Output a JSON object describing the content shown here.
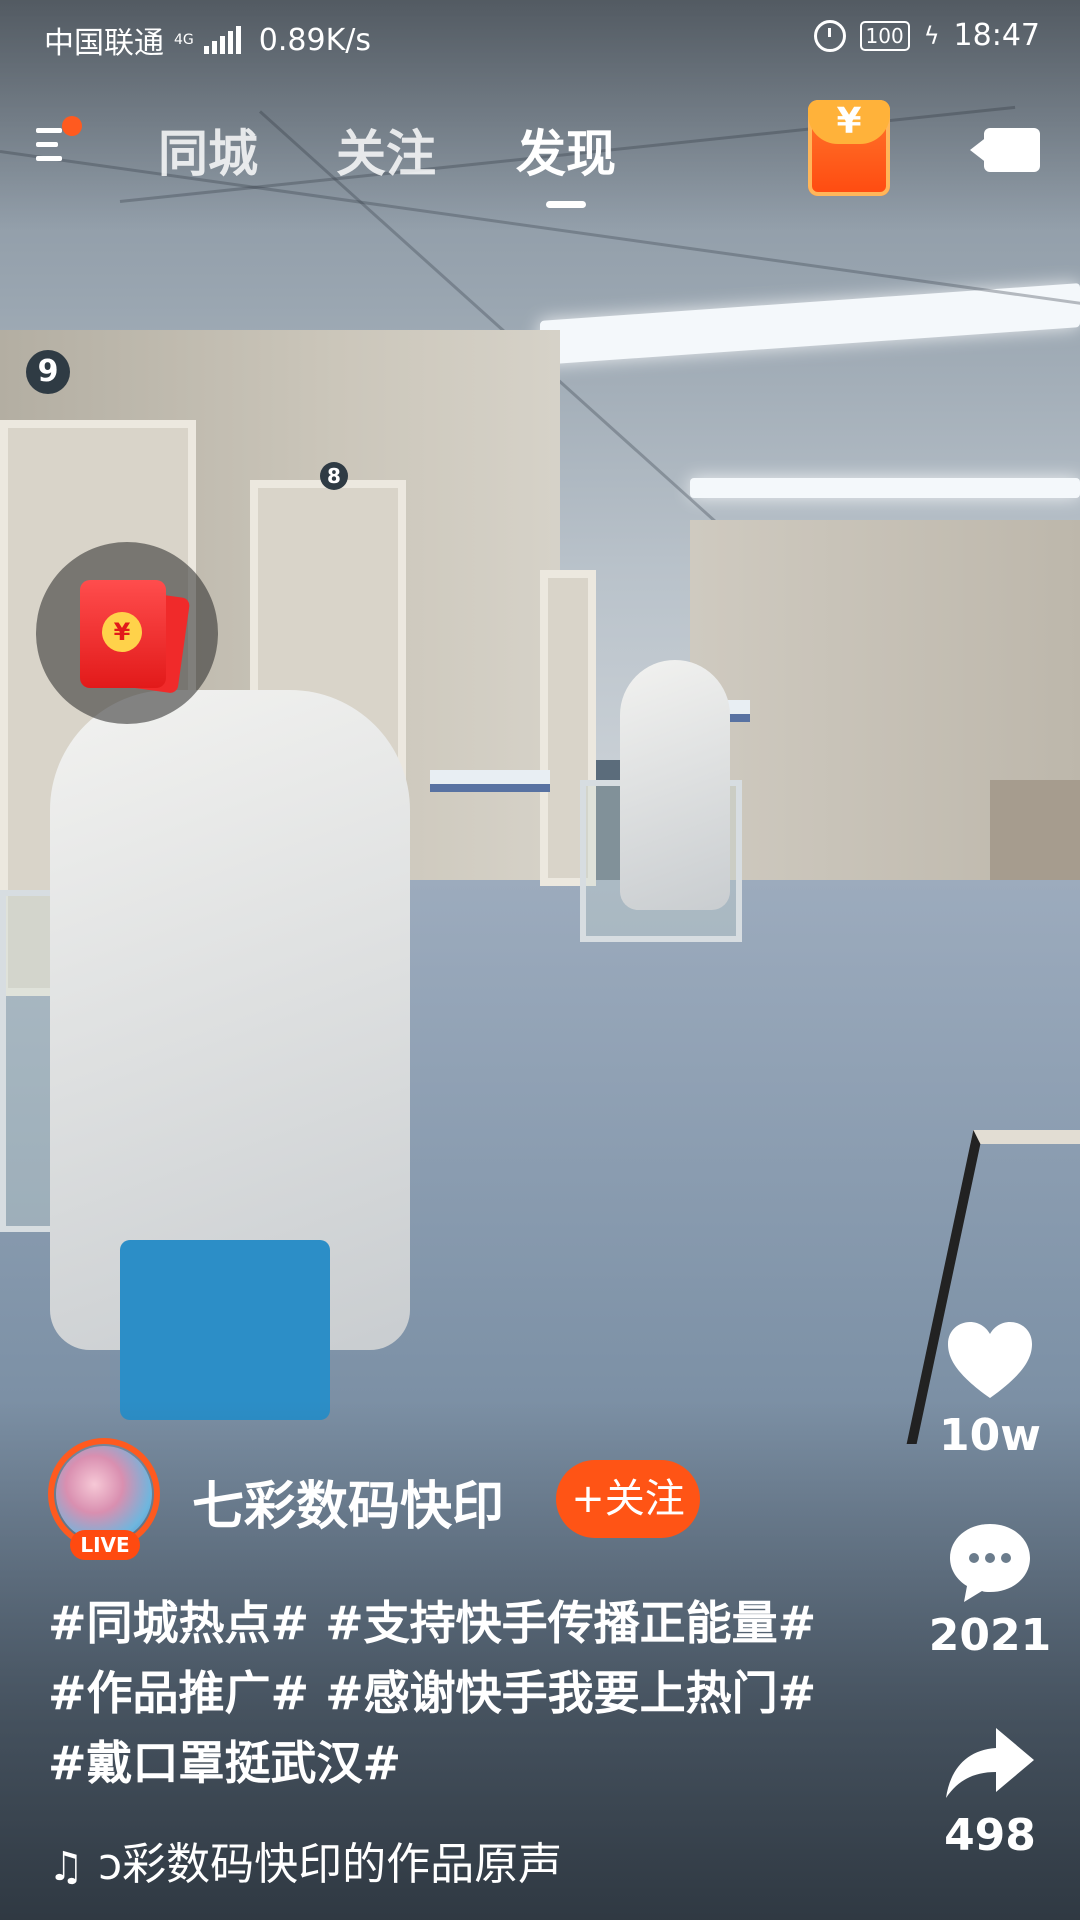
{
  "status_bar": {
    "carrier": "中国联通",
    "network": "4G",
    "speed": "0.89K/s",
    "battery": "100",
    "time": "18:47"
  },
  "nav": {
    "tabs": [
      {
        "label": "同城"
      },
      {
        "label": "关注"
      },
      {
        "label": "发现"
      }
    ],
    "active_tab": "发现",
    "redpack_symbol": "¥"
  },
  "floating_redpack": {
    "symbol": "¥"
  },
  "author": {
    "name": "七彩数码快印",
    "live_badge": "LIVE",
    "follow_label": "+关注"
  },
  "caption": {
    "text": "#同城热点# #支持快手传播正能量# #作品推广# #感谢快手我要上热门# #戴口罩挺武汉#"
  },
  "music": {
    "text": "ɔ彩数码快印的作品原声"
  },
  "actions": {
    "likes": "10w",
    "comments": "2021",
    "shares": "498"
  },
  "colors": {
    "accent": "#ff5415",
    "live_ring": "#ff5a1f"
  },
  "icons": [
    "menu-icon",
    "redpack-icon",
    "camera-icon",
    "heart-icon",
    "comment-icon",
    "share-icon",
    "music-note-icon",
    "alarm-icon",
    "signal-icon",
    "battery-icon"
  ]
}
